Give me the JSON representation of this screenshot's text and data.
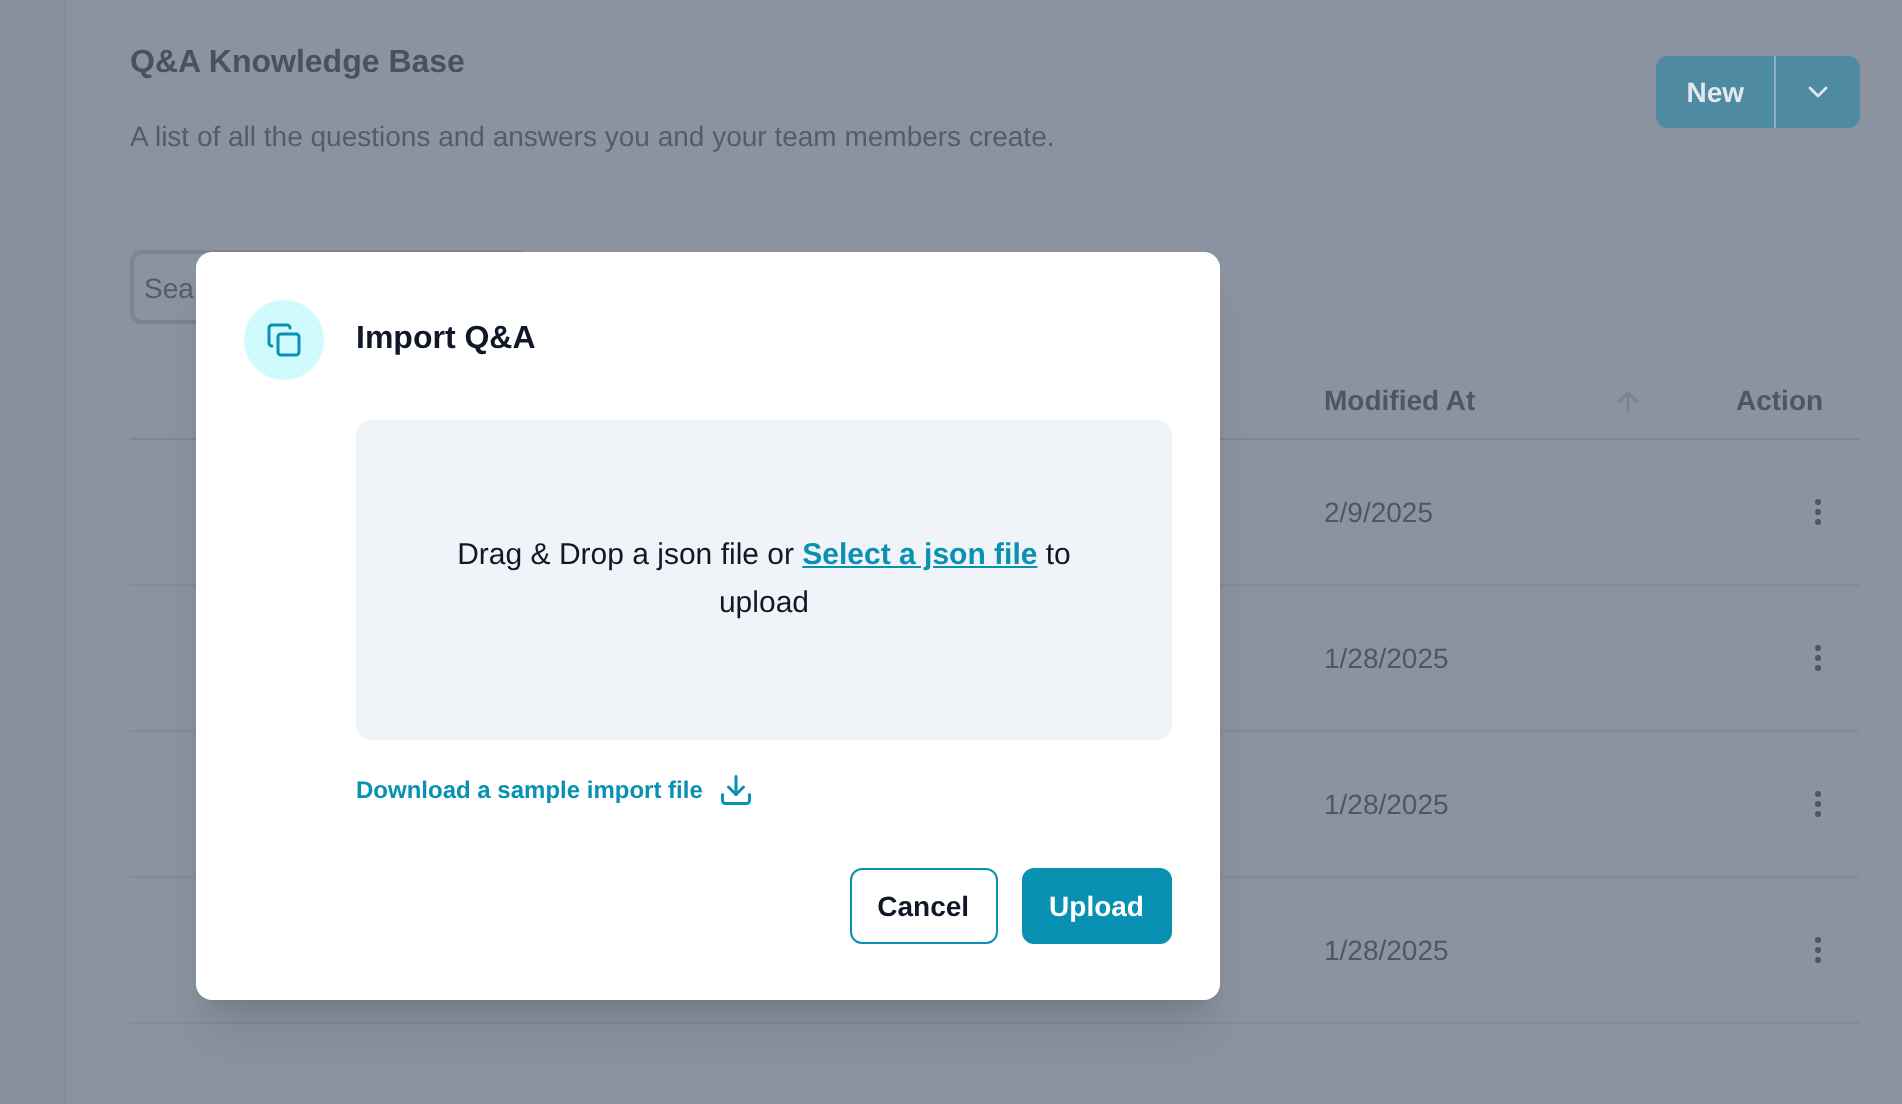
{
  "page": {
    "title": "Q&A Knowledge Base",
    "subtitle": "A list of all the questions and answers you and your team members create.",
    "new_button": "New"
  },
  "search": {
    "placeholder": "Sea"
  },
  "table": {
    "columns": [
      "Modified At",
      "Action"
    ],
    "rows": [
      {
        "modified_at": "2/9/2025"
      },
      {
        "modified_at": "1/28/2025"
      },
      {
        "modified_at": "1/28/2025"
      },
      {
        "modified_at": "1/28/2025"
      }
    ]
  },
  "dialog": {
    "title": "Import Q&A",
    "drop_text": "Drag & Drop a json file or",
    "drop_link": "Select a json file",
    "drop_after": "to upload",
    "download_link": "Download a sample import file",
    "buttons": [
      {
        "label": "Cancel",
        "kind": "secondary"
      },
      {
        "label": "Upload",
        "kind": "primary"
      }
    ]
  }
}
